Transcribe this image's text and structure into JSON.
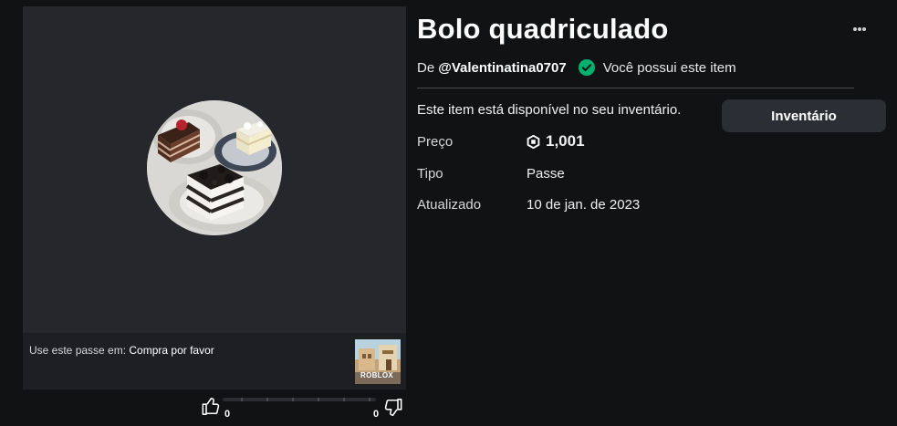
{
  "item": {
    "title": "Bolo quadriculado",
    "by_prefix": "De",
    "creator": "@Valentinatina0707",
    "ownership": "Você possui este item",
    "availability": "Este item está disponível no seu inventário.",
    "inventory_button": "Inventário"
  },
  "details": {
    "price_label": "Preço",
    "price_value": "1,001",
    "type_label": "Tipo",
    "type_value": "Passe",
    "updated_label": "Atualizado",
    "updated_value": "10 de jan. de 2023"
  },
  "place": {
    "prefix": "Use este passe em: ",
    "name": "Compra por favor",
    "thumb_label": "ROBLOX"
  },
  "votes": {
    "up": "0",
    "down": "0"
  },
  "icons": {
    "more": "more-options-icon",
    "verified": "check-circle-icon",
    "currency": "robux-icon",
    "like": "thumbs-up-icon",
    "dislike": "thumbs-down-icon"
  },
  "colors": {
    "background": "#111214",
    "panel": "#25272d",
    "button": "#2c2e35",
    "owned_check": "#00b06f"
  }
}
